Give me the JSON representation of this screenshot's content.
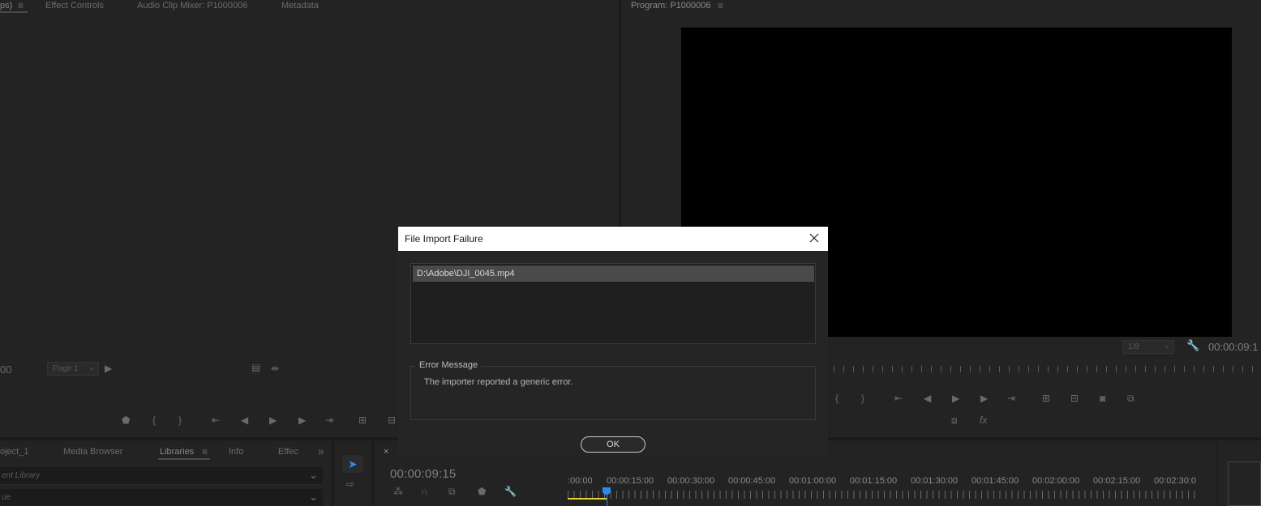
{
  "source_panel": {
    "tabs": [
      {
        "label": "ps)",
        "active": true
      },
      {
        "label": "Effect Controls",
        "active": false
      },
      {
        "label": "Audio Clip Mixer: P1000006",
        "active": false
      },
      {
        "label": "Metadata",
        "active": false
      }
    ],
    "menu_glyph": "≡",
    "timecode_fragment": "00",
    "page_select": "Page 1"
  },
  "program_panel": {
    "title": "Program: P1000006",
    "menu_glyph": "≡",
    "resolution": "1/8",
    "timecode": "00:00:09:1"
  },
  "project_panel": {
    "tabs": [
      {
        "label": "oject_1"
      },
      {
        "label": "Media Browser"
      },
      {
        "label": "Libraries",
        "active": true
      },
      {
        "label": "Info"
      },
      {
        "label": "Effec"
      }
    ],
    "more_glyph": "»",
    "library_dropdown": "ent Library",
    "second_dropdown": "ue"
  },
  "timeline": {
    "close_glyph": "×",
    "timecode": "00:00:09:15",
    "ruler_labels": [
      ":00:00",
      "00:00:15:00",
      "00:00:30:00",
      "00:00:45:00",
      "00:01:00:00",
      "00:01:15:00",
      "00:01:30:00",
      "00:01:45:00",
      "00:02:00:00",
      "00:02:15:00",
      "00:02:30:0"
    ]
  },
  "dialog": {
    "title": "File Import Failure",
    "close_glyph": "✕",
    "files": [
      "D:\\Adobe\\DJI_0045.mp4"
    ],
    "error_legend": "Error Message",
    "error_text": "The importer reported a generic error.",
    "ok_label": "OK"
  },
  "colors": {
    "accent": "#2d8ceb",
    "panel_bg": "#232323",
    "dialog_titlebar": "#ffffff"
  }
}
